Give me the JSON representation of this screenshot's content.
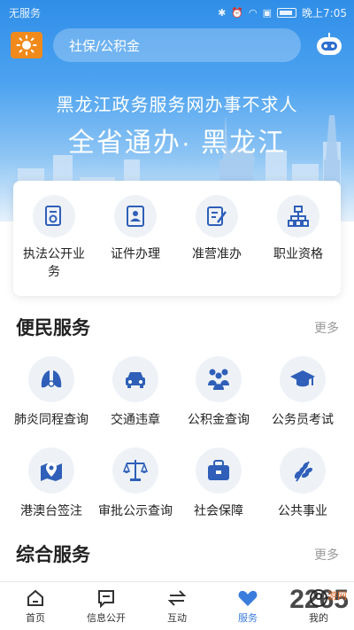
{
  "status": {
    "carrier": "无服务",
    "time": "晚上7:05"
  },
  "topbar": {
    "search_placeholder": "社保/公积金"
  },
  "hero": {
    "slogan": "黑龙江政务服务网办事不求人",
    "headline": "全省通办· 黑龙江"
  },
  "card": {
    "items": [
      {
        "label": "执法公开业务",
        "icon": "document-seal-icon"
      },
      {
        "label": "证件办理",
        "icon": "id-card-icon"
      },
      {
        "label": "准营准办",
        "icon": "edit-doc-icon"
      },
      {
        "label": "职业资格",
        "icon": "org-chart-icon"
      }
    ]
  },
  "convenience": {
    "title": "便民服务",
    "more": "更多",
    "items": [
      {
        "label": "肺炎同程查询",
        "icon": "lungs-icon"
      },
      {
        "label": "交通违章",
        "icon": "car-icon"
      },
      {
        "label": "公积金查询",
        "icon": "people-icon"
      },
      {
        "label": "公务员考试",
        "icon": "graduation-cap-icon"
      },
      {
        "label": "港澳台签注",
        "icon": "map-pin-icon"
      },
      {
        "label": "审批公示查询",
        "icon": "scales-icon"
      },
      {
        "label": "社会保障",
        "icon": "toolbox-icon"
      },
      {
        "label": "公共事业",
        "icon": "wheat-icon"
      }
    ]
  },
  "general": {
    "title": "综合服务",
    "more": "更多"
  },
  "tabs": [
    {
      "label": "首页",
      "icon": "home-icon"
    },
    {
      "label": "信息公开",
      "icon": "message-icon"
    },
    {
      "label": "互动",
      "icon": "exchange-icon"
    },
    {
      "label": "服务",
      "icon": "heart-icon",
      "active": true
    },
    {
      "label": "我的",
      "icon": "user-icon"
    }
  ],
  "watermark": {
    "text": "2265",
    "sub": "游网"
  },
  "colors": {
    "accent": "#3b7ddd",
    "icon_blue": "#2f5fb8",
    "weather": "#f08a1c"
  }
}
